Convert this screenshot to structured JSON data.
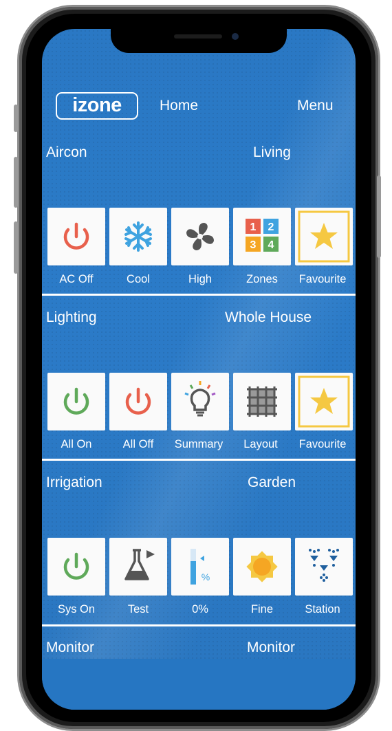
{
  "header": {
    "logo_text": "izone",
    "home_label": "Home",
    "menu_label": "Menu"
  },
  "sections": [
    {
      "title": "Aircon",
      "zone": "Living",
      "tiles": [
        {
          "label": "AC Off",
          "icon": "power-icon",
          "color": "#e8604c"
        },
        {
          "label": "Cool",
          "icon": "snowflake-icon",
          "color": "#3fa3e0"
        },
        {
          "label": "High",
          "icon": "fan-icon",
          "color": "#555555"
        },
        {
          "label": "Zones",
          "icon": "zones-grid-icon",
          "color": "#e8604c"
        },
        {
          "label": "Favourite",
          "icon": "star-icon",
          "color": "#f5c842"
        }
      ]
    },
    {
      "title": "Lighting",
      "zone": "Whole House",
      "tiles": [
        {
          "label": "All On",
          "icon": "power-icon",
          "color": "#5fa95a"
        },
        {
          "label": "All Off",
          "icon": "power-icon",
          "color": "#e8604c"
        },
        {
          "label": "Summary",
          "icon": "lightbulb-icon",
          "color": "#555555"
        },
        {
          "label": "Layout",
          "icon": "grid-layout-icon",
          "color": "#555555"
        },
        {
          "label": "Favourite",
          "icon": "star-icon",
          "color": "#f5c842"
        }
      ]
    },
    {
      "title": "Irrigation",
      "zone": "Garden",
      "tiles": [
        {
          "label": "Sys On",
          "icon": "power-icon",
          "color": "#5fa95a"
        },
        {
          "label": "Test",
          "icon": "flask-icon",
          "color": "#555555"
        },
        {
          "label": "0%",
          "icon": "percent-gauge-icon",
          "color": "#3fa3e0"
        },
        {
          "label": "Fine",
          "icon": "sun-icon",
          "color": "#f5c842"
        },
        {
          "label": "Station",
          "icon": "sprinkler-icon",
          "color": "#1f5f9e"
        }
      ]
    }
  ],
  "monitor": {
    "title": "Monitor",
    "zone": "Monitor"
  }
}
